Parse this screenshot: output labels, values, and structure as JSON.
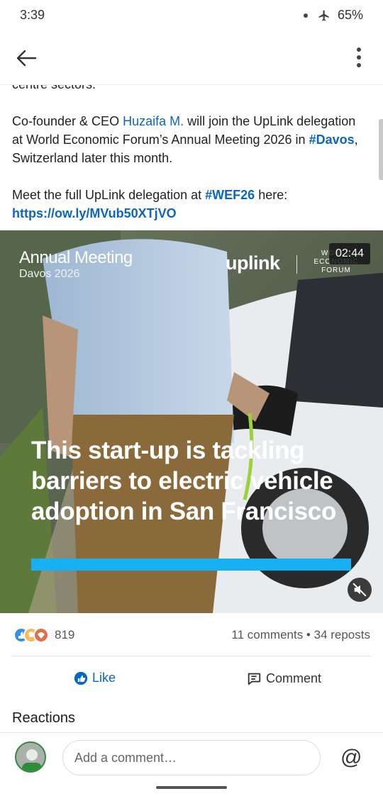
{
  "status_bar": {
    "time": "3:39",
    "battery": "65%"
  },
  "app_bar": {
    "back_icon": "arrow-left-icon",
    "more_icon": "more-vertical-icon"
  },
  "post": {
    "clipped_line": "centre sectors.",
    "para1": {
      "t1": "Co-founder & CEO ",
      "mention": "Huzaifa M.",
      "t2": " will join the UpLink delegation at World Economic Forum’s Annual Meeting 2026 in ",
      "hashtag": "#Davos",
      "t3": ", Switzerland later this month."
    },
    "para2": {
      "t1": "Meet the full UpLink delegation at ",
      "hashtag": "#WEF26",
      "t2": " here:",
      "url": "https://ow.ly/MVub50XTjVO"
    }
  },
  "video": {
    "event_title": "Annual Meeting",
    "event_subtitle": "Davos 2026",
    "brand": "uplink",
    "partner_line1": "WORLD",
    "partner_line2": "ECONOMIC",
    "partner_line3": "FORUM",
    "duration": "02:44",
    "headline": "This start-up is tackling barriers to electric vehicle adoption in San Francisco",
    "accent_color": "#17b0f2",
    "mute_icon": "speaker-muted-icon"
  },
  "social": {
    "reactions_count": "819",
    "comments": "11 comments",
    "separator": " • ",
    "reposts": "34 reposts"
  },
  "actions": {
    "like": "Like",
    "comment": "Comment"
  },
  "reactions_section": {
    "heading": "Reactions"
  },
  "comment_box": {
    "placeholder": "Add a comment…",
    "mention_symbol": "@"
  },
  "colors": {
    "link": "#0a66c2",
    "text": "#1d1d1d"
  }
}
